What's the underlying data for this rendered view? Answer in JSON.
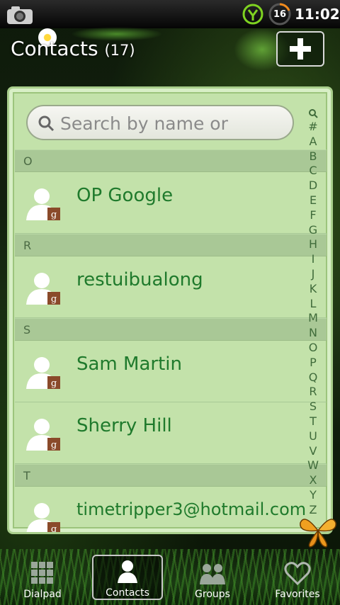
{
  "status_bar": {
    "battery_level": "16",
    "time": "11:02"
  },
  "header": {
    "title": "Contacts",
    "count": "(17)"
  },
  "search": {
    "placeholder": "Search by name or"
  },
  "sections": [
    {
      "letter": "O",
      "contacts": [
        "OP Google"
      ]
    },
    {
      "letter": "R",
      "contacts": [
        "restuibualong"
      ]
    },
    {
      "letter": "S",
      "contacts": [
        "Sam Martin",
        "Sherry Hill"
      ]
    },
    {
      "letter": "T",
      "contacts": [
        "timetripper3@hotmail.com"
      ]
    }
  ],
  "alpha_index": [
    "#",
    "A",
    "B",
    "C",
    "D",
    "E",
    "F",
    "G",
    "H",
    "I",
    "J",
    "K",
    "L",
    "M",
    "N",
    "O",
    "P",
    "Q",
    "R",
    "S",
    "T",
    "U",
    "V",
    "W",
    "X",
    "Y",
    "Z"
  ],
  "bottom_nav": {
    "dialpad": "Dialpad",
    "contacts": "Contacts",
    "groups": "Groups",
    "favorites": "Favorites"
  },
  "colors": {
    "panel": "#c3e2aa",
    "name_text": "#1f7a2c",
    "section_header": "#a9c896"
  }
}
